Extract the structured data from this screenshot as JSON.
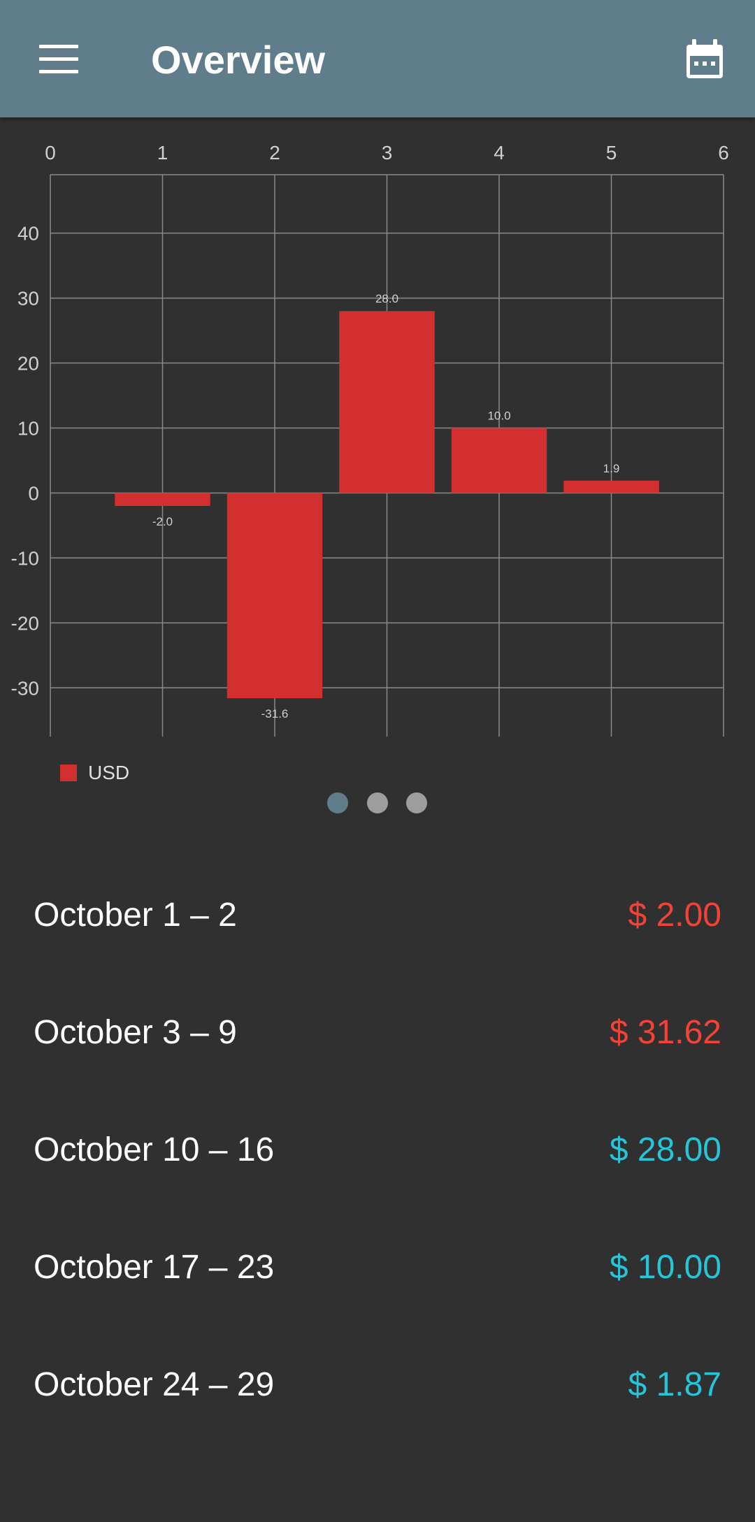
{
  "appbar": {
    "title": "Overview",
    "menu_icon": "menu-icon",
    "calendar_icon": "calendar-icon"
  },
  "colors": {
    "appbar": "#607d8b",
    "background": "#303030",
    "bar": "#d32f2f",
    "negative": "#f44336",
    "positive": "#26c6da",
    "grid": "#8a8a8a",
    "tick": "#d0d0d0",
    "dot_active": "#607d8b",
    "dot_inactive": "#9e9e9e"
  },
  "chart_data": {
    "type": "bar",
    "x": [
      1,
      2,
      3,
      4,
      5
    ],
    "values": [
      -2.0,
      -31.6,
      28.0,
      10.0,
      1.9
    ],
    "value_labels": [
      "-2.0",
      "-31.6",
      "28.0",
      "10.0",
      "1.9"
    ],
    "xlim": [
      0,
      6
    ],
    "ylim": [
      -37.5,
      49
    ],
    "x_ticks": [
      "0",
      "1",
      "2",
      "3",
      "4",
      "5",
      "6"
    ],
    "y_ticks": [
      40,
      30,
      20,
      10,
      0,
      -10,
      -20,
      -30
    ],
    "x_axis_position": "top",
    "grid": true,
    "series": [
      {
        "name": "USD",
        "values": [
          -2.0,
          -31.6,
          28.0,
          10.0,
          1.9
        ]
      }
    ],
    "legend": {
      "label": "USD",
      "placement": "bottom-left"
    }
  },
  "pager": {
    "pages": 3,
    "active": 0
  },
  "list": [
    {
      "period": "October 1 – 2",
      "amount": "$ 2.00",
      "sign": "negative"
    },
    {
      "period": "October 3 – 9",
      "amount": "$ 31.62",
      "sign": "negative"
    },
    {
      "period": "October 10 – 16",
      "amount": "$ 28.00",
      "sign": "positive"
    },
    {
      "period": "October 17 – 23",
      "amount": "$ 10.00",
      "sign": "positive"
    },
    {
      "period": "October 24 – 29",
      "amount": "$ 1.87",
      "sign": "positive"
    }
  ]
}
